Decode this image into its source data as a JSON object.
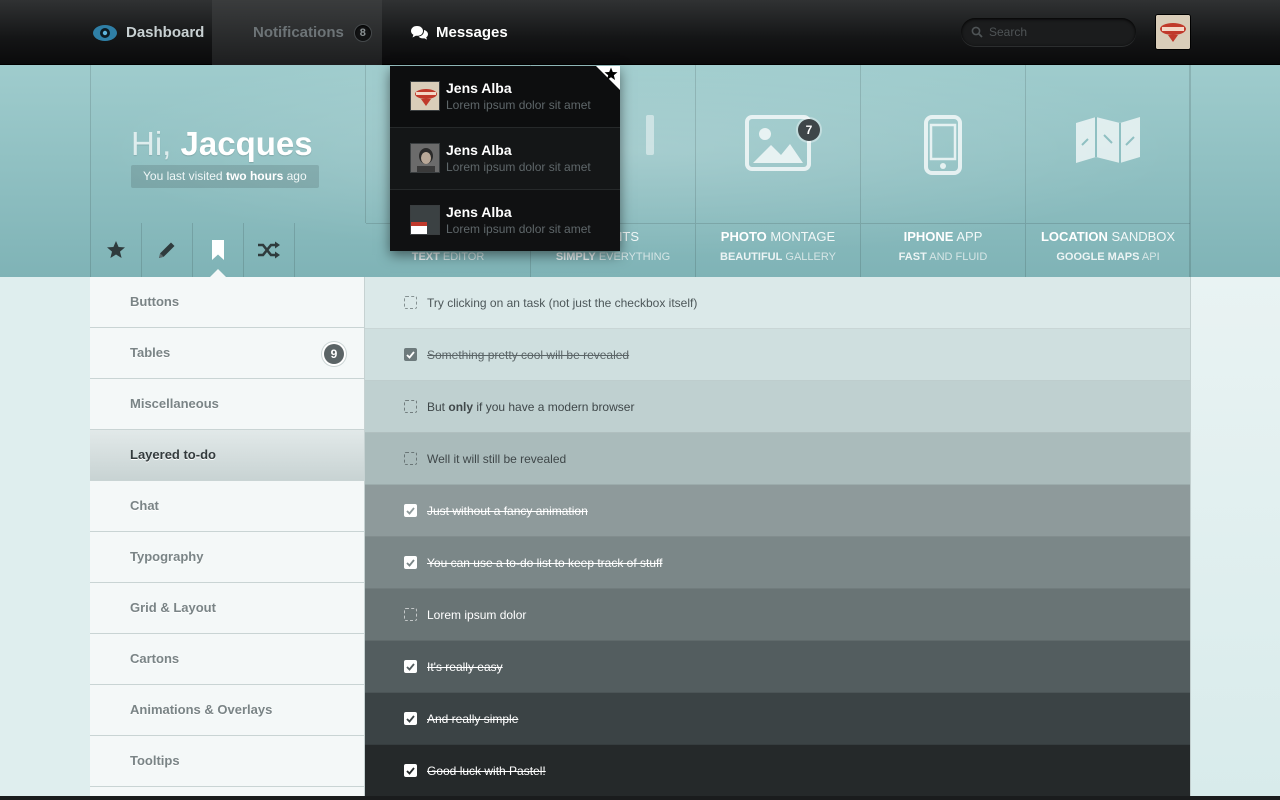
{
  "topbar": {
    "dashboard_label": "Dashboard",
    "notifications_label": "Notifications",
    "notifications_count": "8",
    "messages_label": "Messages",
    "search_placeholder": "Search"
  },
  "messages_dropdown": [
    {
      "name": "Jens Alba",
      "text": "Lorem ipsum dolor sit amet"
    },
    {
      "name": "Jens Alba",
      "text": "Lorem ipsum dolor sit amet"
    },
    {
      "name": "Jens Alba",
      "text": "Lorem ipsum dolor sit amet"
    }
  ],
  "greeting": {
    "hi": "Hi,",
    "name": "Jacques",
    "last_visited_prefix": "You last visited",
    "last_visited_bold": "two hours",
    "last_visited_suffix": "ago"
  },
  "toolbar_icons": [
    "star-icon",
    "pencil-icon",
    "bookmark-icon",
    "shuffle-icon"
  ],
  "tiles": [
    {
      "title_bold": "",
      "title": "EVENTS",
      "sub_bold": "SIMPLY",
      "sub": "EVERYTHING",
      "icon": "calendar-icon"
    },
    {
      "title_bold": "PHOTO",
      "title": "MONTAGE",
      "sub_bold": "BEAUTIFUL",
      "sub": "GALLERY",
      "icon": "image-icon",
      "badge": "7"
    },
    {
      "title_bold": "IPHONE",
      "title": "APP",
      "sub_bold": "FAST",
      "sub": "AND FLUID",
      "icon": "phone-icon"
    },
    {
      "title_bold": "LOCATION",
      "title": "SANDBOX",
      "sub_bold": "GOOGLE MAPS",
      "sub": "API",
      "icon": "map-icon"
    }
  ],
  "text_editor_tile": {
    "sub_bold": "TEXT",
    "sub": "EDITOR"
  },
  "sidebar": {
    "items": [
      {
        "label": "Buttons"
      },
      {
        "label": "Tables",
        "badge": "9"
      },
      {
        "label": "Miscellaneous"
      },
      {
        "label": "Layered to-do",
        "active": true
      },
      {
        "label": "Chat"
      },
      {
        "label": "Typography"
      },
      {
        "label": "Grid & Layout"
      },
      {
        "label": "Cartons"
      },
      {
        "label": "Animations & Overlays"
      },
      {
        "label": "Tooltips"
      }
    ]
  },
  "todos": [
    {
      "text": "Try clicking on an task (not just the checkbox itself)",
      "done": false,
      "bg": "#dbe9e9",
      "fg": "#4d5759"
    },
    {
      "text": "Something pretty cool will be revealed",
      "done": true,
      "bg": "#cfdfdf",
      "fg": "#5b6567"
    },
    {
      "text_pre": "But ",
      "text_bold": "only",
      "text_post": " if you have a modern browser",
      "done": false,
      "bg": "#bfd0d0",
      "fg": "#3f4749"
    },
    {
      "text": "Well it will still be revealed",
      "done": false,
      "bg": "#aabbbb",
      "fg": "#3f4749"
    },
    {
      "text": "Just without a fancy animation",
      "done": true,
      "bg": "#8e9a9b",
      "fg": "#ffffff"
    },
    {
      "text": "You can use a to-do list to keep track of stuff",
      "done": true,
      "bg": "#7b8788",
      "fg": "#ffffff"
    },
    {
      "text": "Lorem ipsum dolor",
      "done": false,
      "bg": "#697475",
      "fg": "#ffffff"
    },
    {
      "text": "It's really easy",
      "done": true,
      "bg": "#535d5f",
      "fg": "#ffffff"
    },
    {
      "text": "And really simple",
      "done": true,
      "bg": "#3b4345",
      "fg": "#ffffff"
    },
    {
      "text": "Good luck with Pastel!",
      "done": true,
      "bg": "#25292a",
      "fg": "#ffffff"
    }
  ]
}
